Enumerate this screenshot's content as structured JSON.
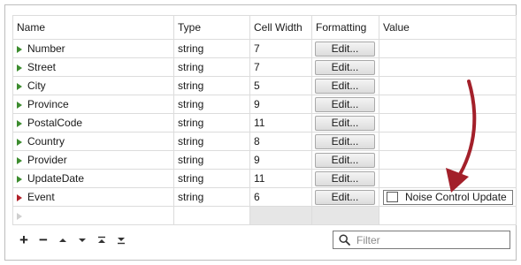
{
  "table": {
    "headers": [
      "Name",
      "Type",
      "Cell Width",
      "Formatting",
      "Value"
    ],
    "rows": [
      {
        "name": "Number",
        "type": "string",
        "cell_width": "7",
        "formatting": "Edit...",
        "value": "",
        "marker": "green"
      },
      {
        "name": "Street",
        "type": "string",
        "cell_width": "7",
        "formatting": "Edit...",
        "value": "",
        "marker": "green"
      },
      {
        "name": "City",
        "type": "string",
        "cell_width": "5",
        "formatting": "Edit...",
        "value": "",
        "marker": "green"
      },
      {
        "name": "Province",
        "type": "string",
        "cell_width": "9",
        "formatting": "Edit...",
        "value": "",
        "marker": "green"
      },
      {
        "name": "PostalCode",
        "type": "string",
        "cell_width": "11",
        "formatting": "Edit...",
        "value": "",
        "marker": "green"
      },
      {
        "name": "Country",
        "type": "string",
        "cell_width": "8",
        "formatting": "Edit...",
        "value": "",
        "marker": "green"
      },
      {
        "name": "Provider",
        "type": "string",
        "cell_width": "9",
        "formatting": "Edit...",
        "value": "",
        "marker": "green"
      },
      {
        "name": "UpdateDate",
        "type": "string",
        "cell_width": "11",
        "formatting": "Edit...",
        "value": "",
        "marker": "green"
      },
      {
        "name": "Event",
        "type": "string",
        "cell_width": "6",
        "formatting": "Edit...",
        "value": "Noise Control Update",
        "marker": "red"
      }
    ]
  },
  "toolbar": {
    "add_symbol": "+",
    "remove_symbol": "−"
  },
  "filter": {
    "placeholder": "Filter",
    "value": ""
  },
  "colors": {
    "marker_green": "#3d8c2f",
    "marker_red": "#b0212a",
    "annotation_arrow": "#a3202a"
  }
}
